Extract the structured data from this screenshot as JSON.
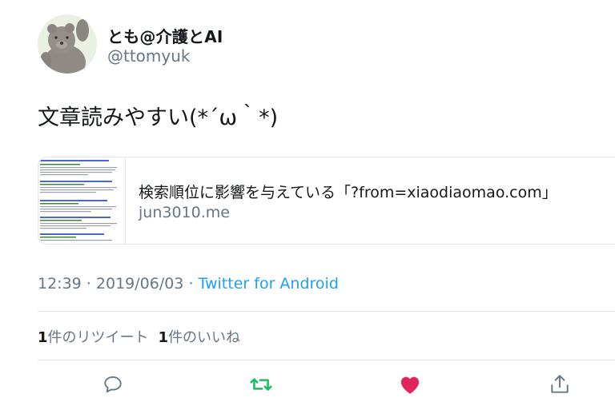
{
  "tweet": {
    "display_name": "とも@介護とAI",
    "handle": "@ttomyuk",
    "text": "文章読みやすい(*´ω｀*)",
    "card": {
      "title": "検索順位に影響を与えている「?from=xiaodiaomao.com」",
      "domain": "jun3010.me"
    },
    "time": "12:39",
    "date": "2019/06/03",
    "separator": " · ",
    "source": "Twitter for Android",
    "retweets": {
      "count": "1",
      "label": "件のリツイート"
    },
    "likes": {
      "count": "1",
      "label": "件のいいね"
    }
  },
  "actions": [
    {
      "name": "reply",
      "icon": "reply-icon",
      "color": "#657786"
    },
    {
      "name": "retweet",
      "icon": "retweet-icon",
      "color": "#17bf63"
    },
    {
      "name": "like",
      "icon": "heart-icon",
      "color": "#e0245e"
    },
    {
      "name": "share",
      "icon": "share-icon",
      "color": "#657786"
    }
  ],
  "colors": {
    "accent": "#1da1f2",
    "muted": "#657786",
    "retweet_active": "#17bf63",
    "like_active": "#e0245e"
  }
}
